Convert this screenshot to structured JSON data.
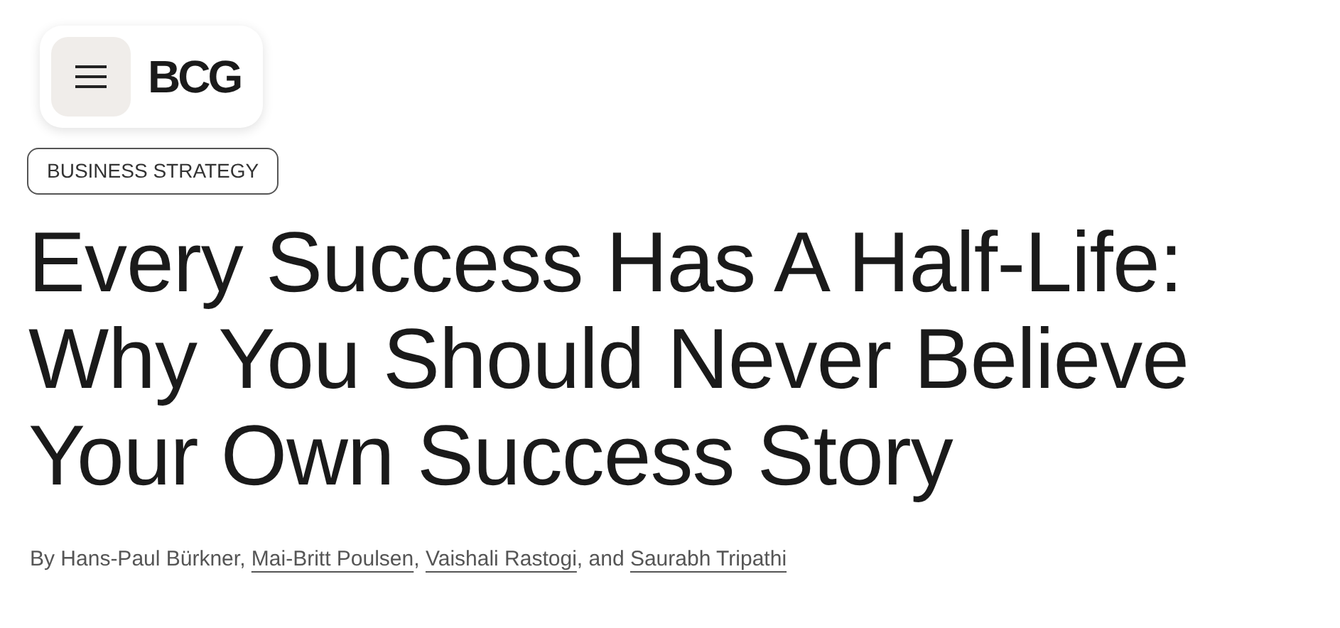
{
  "header": {
    "logo": "BCG"
  },
  "tag": "BUSINESS STRATEGY",
  "title": "Every Success Has A Half-Life: Why You Should Never Believe Your Own Success Story",
  "byline": [
    {
      "kind": "text",
      "text": "By Hans-Paul Bürkner, "
    },
    {
      "kind": "link",
      "text": "Mai-Britt Poulsen"
    },
    {
      "kind": "text",
      "text": ", "
    },
    {
      "kind": "link",
      "text": "Vaishali Rastogi"
    },
    {
      "kind": "text",
      "text": ", and "
    },
    {
      "kind": "link",
      "text": "Saurabh Tripathi"
    }
  ]
}
